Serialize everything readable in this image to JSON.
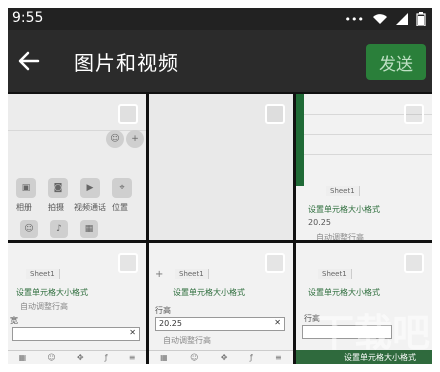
{
  "status_bar": {
    "time": "9:55",
    "signal_icons": [
      "dots-icon",
      "wifi-icon",
      "signal-icon",
      "battery-icon"
    ]
  },
  "app_bar": {
    "back_icon": "arrow-left-icon",
    "title": "图片和视频",
    "send_label": "发送"
  },
  "grid": {
    "tiles": [
      {
        "id": 1,
        "kind": "chat-attachments"
      },
      {
        "id": 2,
        "kind": "blank"
      },
      {
        "id": 3,
        "kind": "spreadsheet",
        "sheet_tab": "Sheet1",
        "menu_label": "设置单元格大小格式",
        "cell_value": "20.25",
        "option_label": "自动调整行高"
      },
      {
        "id": 4,
        "kind": "spreadsheet",
        "sheet_tab": "Sheet1",
        "menu_label": "设置单元格大小格式",
        "option_label": "自动调整行高",
        "field_label": "宽"
      },
      {
        "id": 5,
        "kind": "spreadsheet",
        "sheet_tab": "Sheet1",
        "menu_label": "设置单元格大小格式",
        "field_label": "行高",
        "cell_value": "20.25",
        "option_label": "自动调整行高"
      },
      {
        "id": 6,
        "kind": "spreadsheet",
        "sheet_tab": "Sheet1",
        "menu_label": "设置单元格大小格式",
        "field_label": "行高",
        "bottom_label": "设置单元格大小格式"
      }
    ]
  },
  "attachment_icons": [
    {
      "label": "相册"
    },
    {
      "label": "拍摄"
    },
    {
      "label": "视频通话"
    },
    {
      "label": "位置"
    }
  ],
  "watermark": {
    "text": "下载吧"
  }
}
